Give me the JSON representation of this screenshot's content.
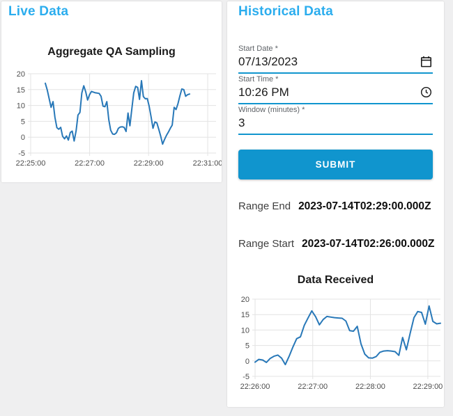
{
  "page": {
    "background_color": "#efeff0",
    "accent_color": "#1095ce",
    "header_color": "#2badee"
  },
  "live_panel": {
    "title": "Live Data",
    "title_color": "#2badee"
  },
  "historical_panel": {
    "title": "Historical Data",
    "title_color": "#2badee",
    "fields": {
      "start_date": {
        "label": "Start Date *",
        "value": "07/13/2023",
        "icon": "calendar-icon"
      },
      "start_time": {
        "label": "Start Time *",
        "value": "10:26 PM",
        "icon": "clock-icon"
      },
      "window": {
        "label": "Window (minutes) *",
        "value": "3",
        "icon": null
      }
    },
    "submit": {
      "label": "SUBMIT",
      "background": "#1095ce"
    },
    "range_end": {
      "label": "Range End",
      "value": "2023-07-14T02:29:00.000Z"
    },
    "range_start": {
      "label": "Range Start",
      "value": "2023-07-14T02:26:00.000Z"
    }
  },
  "chart_data": [
    {
      "id": "aggregate_qa_sampling",
      "type": "line",
      "title": "Aggregate QA Sampling",
      "xlabel": "",
      "ylabel": "",
      "line_color": "#2878b8",
      "grid": true,
      "legend": false,
      "y_axis": {
        "ticks": [
          20,
          15,
          10,
          5,
          0,
          -5
        ],
        "range": [
          -5,
          20
        ]
      },
      "x_axis": {
        "ticks": [
          "22:25:00",
          "22:27:00",
          "22:29:00",
          "22:31:00"
        ]
      },
      "series_span": {
        "start": "22:25:30",
        "end": "22:30:25"
      },
      "values": [
        17.0,
        14.9,
        12.2,
        9.4,
        11.2,
        6.3,
        3.0,
        2.5,
        3.1,
        0.3,
        -0.5,
        0.4,
        -0.9,
        1.5,
        1.9,
        -1.2,
        2.0,
        7.0,
        7.8,
        13.9,
        16.2,
        14.3,
        11.7,
        13.4,
        14.4,
        14.2,
        14.0,
        13.9,
        13.8,
        12.9,
        9.8,
        9.6,
        11.2,
        5.5,
        2.2,
        1.0,
        0.9,
        1.4,
        2.8,
        3.2,
        3.3,
        3.1,
        1.8,
        7.6,
        3.6,
        9.0,
        14.0,
        16.0,
        15.7,
        11.9,
        17.8,
        12.8,
        12.1,
        12.2,
        9.8,
        6.4,
        2.8,
        4.8,
        4.5,
        2.5,
        0.3,
        -2.2,
        -0.7,
        0.6,
        1.6,
        2.8,
        3.8,
        9.4,
        8.7,
        10.6,
        13.1,
        15.2,
        15.0,
        12.9,
        13.4,
        13.6
      ]
    },
    {
      "id": "data_received",
      "type": "line",
      "title": "Data Received",
      "xlabel": "",
      "ylabel": "",
      "line_color": "#2878b8",
      "grid": true,
      "legend": false,
      "y_axis": {
        "ticks": [
          20,
          15,
          10,
          5,
          0,
          -5
        ],
        "range": [
          -5,
          20
        ]
      },
      "x_axis": {
        "ticks": [
          "22:26:00",
          "22:27:00",
          "22:28:00",
          "22:29:00"
        ]
      },
      "series_span": {
        "start": "22:26:00",
        "end": "22:29:10"
      },
      "values": [
        -0.4,
        0.5,
        0.3,
        -0.5,
        0.8,
        1.5,
        1.9,
        0.9,
        -1.2,
        1.5,
        4.5,
        7.2,
        7.8,
        11.5,
        13.9,
        16.2,
        14.3,
        11.7,
        13.4,
        14.4,
        14.2,
        14.0,
        13.9,
        13.8,
        12.9,
        9.8,
        9.6,
        11.2,
        5.5,
        2.2,
        1.0,
        0.9,
        1.4,
        2.8,
        3.2,
        3.3,
        3.2,
        3.0,
        1.8,
        7.6,
        3.6,
        9.0,
        14.0,
        16.0,
        15.7,
        11.9,
        17.8,
        12.8,
        12.0,
        12.2
      ]
    }
  ]
}
